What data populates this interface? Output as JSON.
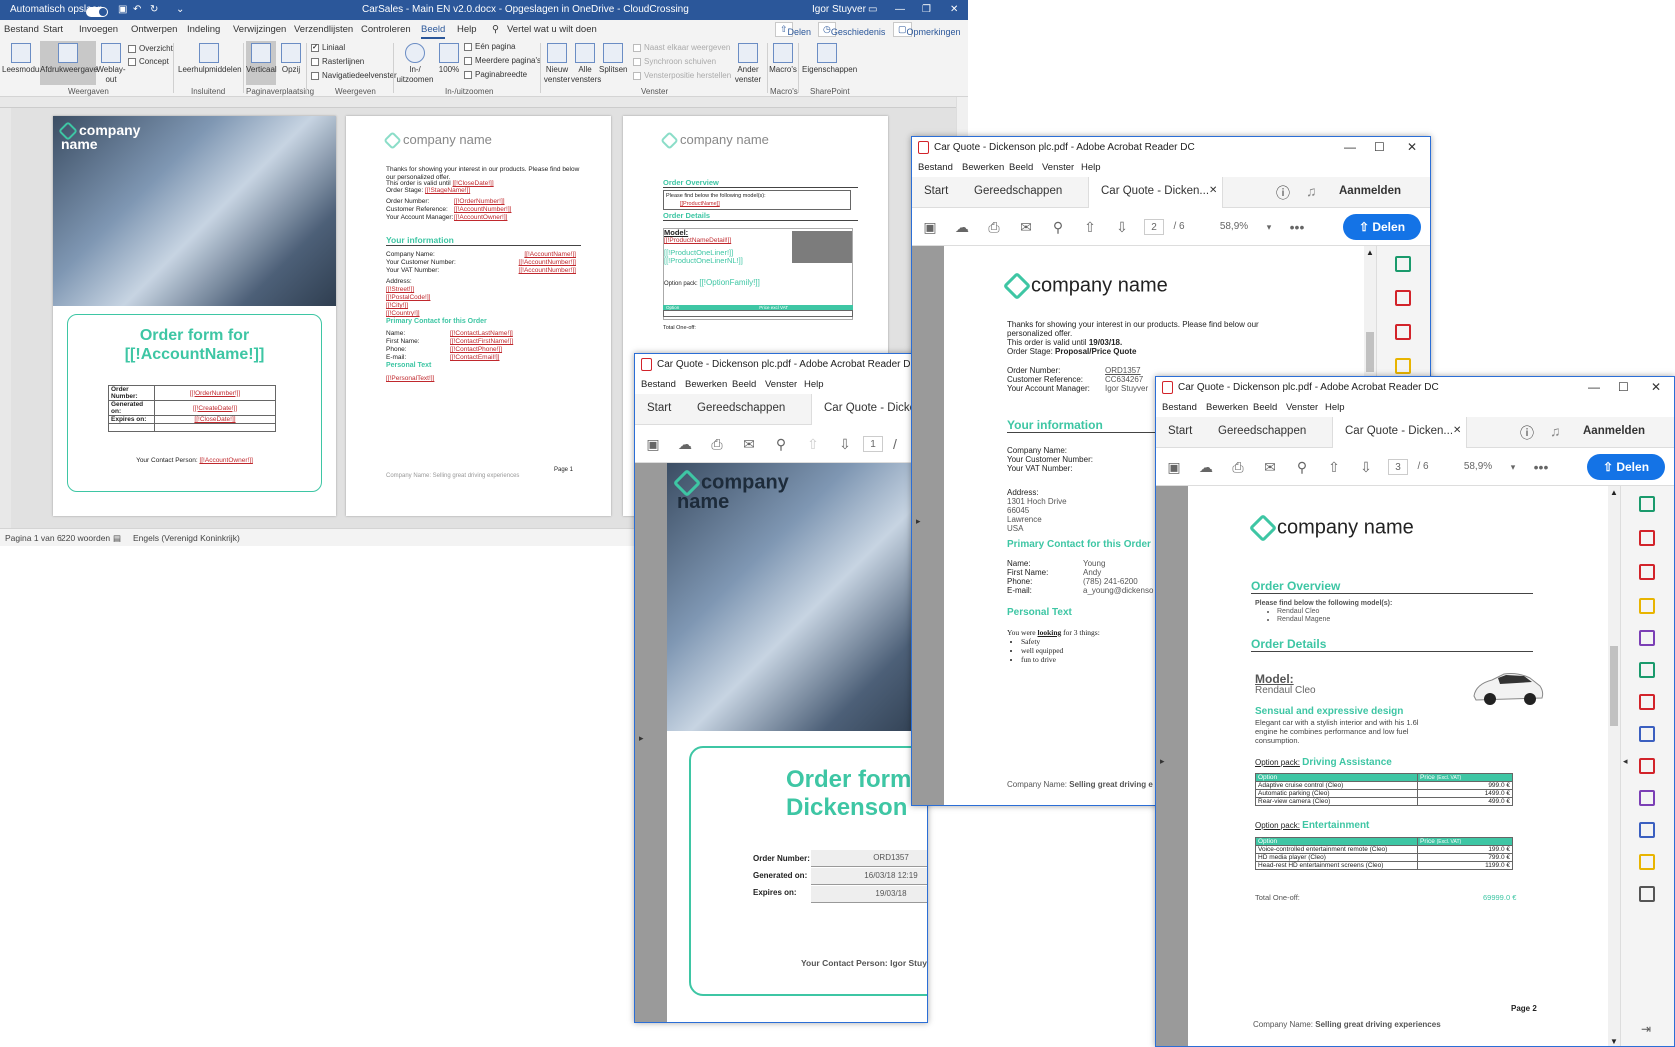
{
  "word": {
    "autosave": "Automatisch opslaan",
    "doc_title": "CarSales - Main EN v2.0.docx  -  Opgeslagen in OneDrive - CloudCrossing",
    "user": "Igor Stuyver",
    "tabs": [
      "Bestand",
      "Start",
      "Invoegen",
      "Ontwerpen",
      "Indeling",
      "Verwijzingen",
      "Verzendlijsten",
      "Controleren",
      "Beeld",
      "Help"
    ],
    "active_tab": "Beeld",
    "tell_me": "Vertel wat u wilt doen",
    "share": "Delen",
    "history": "Geschiedenis",
    "comments": "Opmerkingen",
    "ribbon": {
      "leesmodus": "Leesmodus",
      "afdruk": "Afdrukweergave",
      "weblay1": "Weblay-",
      "weblay2": "out",
      "overzicht": "Overzicht",
      "concept": "Concept",
      "leerhulp": "Leerhulpmiddelen",
      "verticaal": "Verticaal",
      "opzij": "Opzij",
      "liniaal": "Liniaal",
      "rasterlijnen": "Rasterlijnen",
      "navigatie": "Navigatiedeelvenster",
      "zoom1": "In-/",
      "zoom2": "uitzoomen",
      "zoom100": "100%",
      "eenpagina": "Eén pagina",
      "meerdere": "Meerdere pagina's",
      "paginabreedte": "Paginabreedte",
      "nieuw1": "Nieuw",
      "nieuw2": "venster",
      "alle1": "Alle",
      "alle2": "vensters",
      "splitsen": "Splitsen",
      "naast": "Naast elkaar weergeven",
      "synchroon": "Synchroon schuiven",
      "vensterpositie": "Vensterpositie herstellen",
      "ander1": "Ander",
      "ander2": "venster",
      "macros": "Macro's",
      "eigenschappen": "Eigenschappen",
      "groups": [
        "Weergaven",
        "Insluitend",
        "Paginaverplaatsing",
        "Weergeven",
        "In-/uitzoomen",
        "Venster",
        "Macro's",
        "SharePoint"
      ]
    },
    "status": {
      "page": "Pagina 1 van 6",
      "words": "220 woorden",
      "lang": "Engels (Verenigd Koninkrijk)"
    },
    "page1": {
      "logo": "company name",
      "title1": "Order form for",
      "title2": "[[!AccountName!]]",
      "rows": [
        {
          "k": "Order Number:",
          "v": "[[!OrderNumber!]]"
        },
        {
          "k": "Generated on:",
          "v": "[[!CreateDate!]]"
        },
        {
          "k": "Expires on:",
          "v": "[[!CloseDate!]]"
        }
      ],
      "contact_label": "Your Contact Person:",
      "contact_val": "[[!AccountOwner!]]"
    },
    "page2": {
      "logo": "company name",
      "intro": "Thanks for showing your interest in our products. Please find below our personalized offer.",
      "valid": "This order is valid until",
      "valid_val": "[[!CloseDate!]]",
      "stage": "Order Stage:",
      "stage_val": "[[!StageName!]]",
      "rows": [
        {
          "k": "Order Number:",
          "v": "[[!OrderNumber!]]"
        },
        {
          "k": "Customer Reference:",
          "v": "[[!AccountNumber!]]"
        },
        {
          "k": "Your Account Manager:",
          "v": "[[!AccountOwner!]]"
        }
      ],
      "your_info": "Your information",
      "info_rows": [
        {
          "k": "Company Name:",
          "v": "[[!AccountName!]]"
        },
        {
          "k": "Your Customer Number:",
          "v": "[[!AccountNumber!]]"
        },
        {
          "k": "Your VAT Number:",
          "v": "[[!AccountNumber!]]"
        }
      ],
      "address": "Address:",
      "addr_lines": [
        "[[!Street!]]",
        "[[!PostalCode!]]",
        "[[!City!]]",
        "[[!Country!]]"
      ],
      "primary": "Primary Contact for this Order",
      "contact_rows": [
        {
          "k": "Name:",
          "v": "[[!ContactLastName!]]"
        },
        {
          "k": "First Name:",
          "v": "[[!ContactFirstName!]]"
        },
        {
          "k": "Phone:",
          "v": "[[!ContactPhone!]]"
        },
        {
          "k": "E-mail:",
          "v": "[[!ContactEmail!]]"
        }
      ],
      "personal": "Personal Text",
      "personal_val": "[[!PersonalText!]]",
      "footer": "Company Name: Selling great driving experiences",
      "page_no": "Page 1"
    },
    "page3": {
      "logo": "company name",
      "overview": "Order Overview",
      "find": "Please find below the following model(s):",
      "prod": "[[ProductName]]",
      "details": "Order Details",
      "model": "Model:",
      "model_val": "[[!ProductNameDetail!]]",
      "lines1": "[[!ProductOneLiner!]]",
      "lines2": "[[!ProductOneLinerNL!]]",
      "option": "Option pack:",
      "option_val": "[[!OptionFamily!]]",
      "opt_col": "Option",
      "price_col": "Price excl VAT",
      "total": "Total One-off:"
    }
  },
  "acro_common": {
    "menu": [
      "Bestand",
      "Bewerken",
      "Beeld",
      "Venster",
      "Help"
    ],
    "start": "Start",
    "tools": "Gereedschappen",
    "signin": "Aanmelden",
    "share": "Delen",
    "zoom": "58,9%",
    "total_pages": "/ 6"
  },
  "acro1": {
    "title": "Car Quote - Dickenson plc.pdf - Adobe Acrobat Reader DC",
    "tab": "Car Quote - Dicke",
    "page": "1",
    "logo": "company name",
    "order_title1": "Order form",
    "order_title2": "Dickenson",
    "rows": [
      {
        "k": "Order Number:",
        "v": "ORD1357"
      },
      {
        "k": "Generated on:",
        "v": "16/03/18 12:19"
      },
      {
        "k": "Expires on:",
        "v": "19/03/18"
      }
    ],
    "contact": "Your Contact Person: Igor Stuyver"
  },
  "acro2": {
    "title": "Car Quote - Dickenson plc.pdf - Adobe Acrobat Reader DC",
    "tab": "Car Quote - Dicken...",
    "page": "2",
    "logo": "company name",
    "intro": "Thanks for showing your interest in our products. Please find below our personalized offer.",
    "valid": "This order is valid until",
    "valid_val": "19/03/18.",
    "stage": "Order Stage:",
    "stage_val": "Proposal/Price Quote",
    "rows": [
      {
        "k": "Order Number:",
        "v": "ORD1357"
      },
      {
        "k": "Customer Reference:",
        "v": "CC634267"
      },
      {
        "k": "Your Account Manager:",
        "v": "Igor Stuyver"
      }
    ],
    "your_info": "Your information",
    "info_rows": [
      "Company Name:",
      "Your Customer Number:",
      "Your VAT Number:"
    ],
    "address": "Address:",
    "addr_lines": [
      "1301 Hoch Drive",
      "66045",
      "Lawrence",
      "USA"
    ],
    "primary": "Primary Contact for this Order",
    "contact_rows": [
      {
        "k": "Name:",
        "v": "Young"
      },
      {
        "k": "First Name:",
        "v": "Andy"
      },
      {
        "k": "Phone:",
        "v": "(785) 241-6200"
      },
      {
        "k": "E-mail:",
        "v": "a_young@dickenso"
      }
    ],
    "personal": "Personal Text",
    "want_pre": "You were",
    "want_key": "looking",
    "want_post": "for 3 things:",
    "bullets": [
      "Safety",
      "well equipped",
      "fun to drive"
    ],
    "footer_pre": "Company Name:",
    "footer_val": "Selling great driving e"
  },
  "acro3": {
    "title": "Car Quote - Dickenson plc.pdf - Adobe Acrobat Reader DC",
    "tab": "Car Quote - Dicken...",
    "page": "3",
    "logo": "company name",
    "overview": "Order Overview",
    "find": "Please find below the following model(s):",
    "models": [
      "Rendaul Cleo",
      "Rendaul Magene"
    ],
    "details": "Order Details",
    "model": "Model:",
    "model_val": "Rendaul Cleo",
    "tagline": "Sensual and expressive design",
    "desc": "Elegant car with a stylish interior and with his 1.6l engine he combines performance and low fuel consumption.",
    "opt_label": "Option pack:",
    "opt1": "Driving Assistance",
    "opt2": "Entertainment",
    "opt_col": "Option",
    "price_col": "Price",
    "price_sub": "(Excl. VAT)",
    "table1": [
      {
        "o": "Adaptive cruise control (Cleo)",
        "p": "999.0 €"
      },
      {
        "o": "Automatic parking (Cleo)",
        "p": "1499.0 €"
      },
      {
        "o": "Rear-view camera (Cleo)",
        "p": "499.0 €"
      }
    ],
    "table2": [
      {
        "o": "Voice-controlled entertainment remote (Cleo)",
        "p": "199.0 €"
      },
      {
        "o": "HD media player (Cleo)",
        "p": "799.0 €"
      },
      {
        "o": "Head-rest HD entertainment screens (Cleo)",
        "p": "1199.0 €"
      }
    ],
    "total": "Total One-off:",
    "total_val": "69999.0 €",
    "page_no": "Page 2",
    "footer_pre": "Company Name:",
    "footer_val": "Selling great driving experiences"
  },
  "colors": {
    "word_blue": "#2b579a",
    "teal": "#3ec6a4",
    "acro_blue": "#1473e6",
    "link_red": "#c0282d"
  }
}
